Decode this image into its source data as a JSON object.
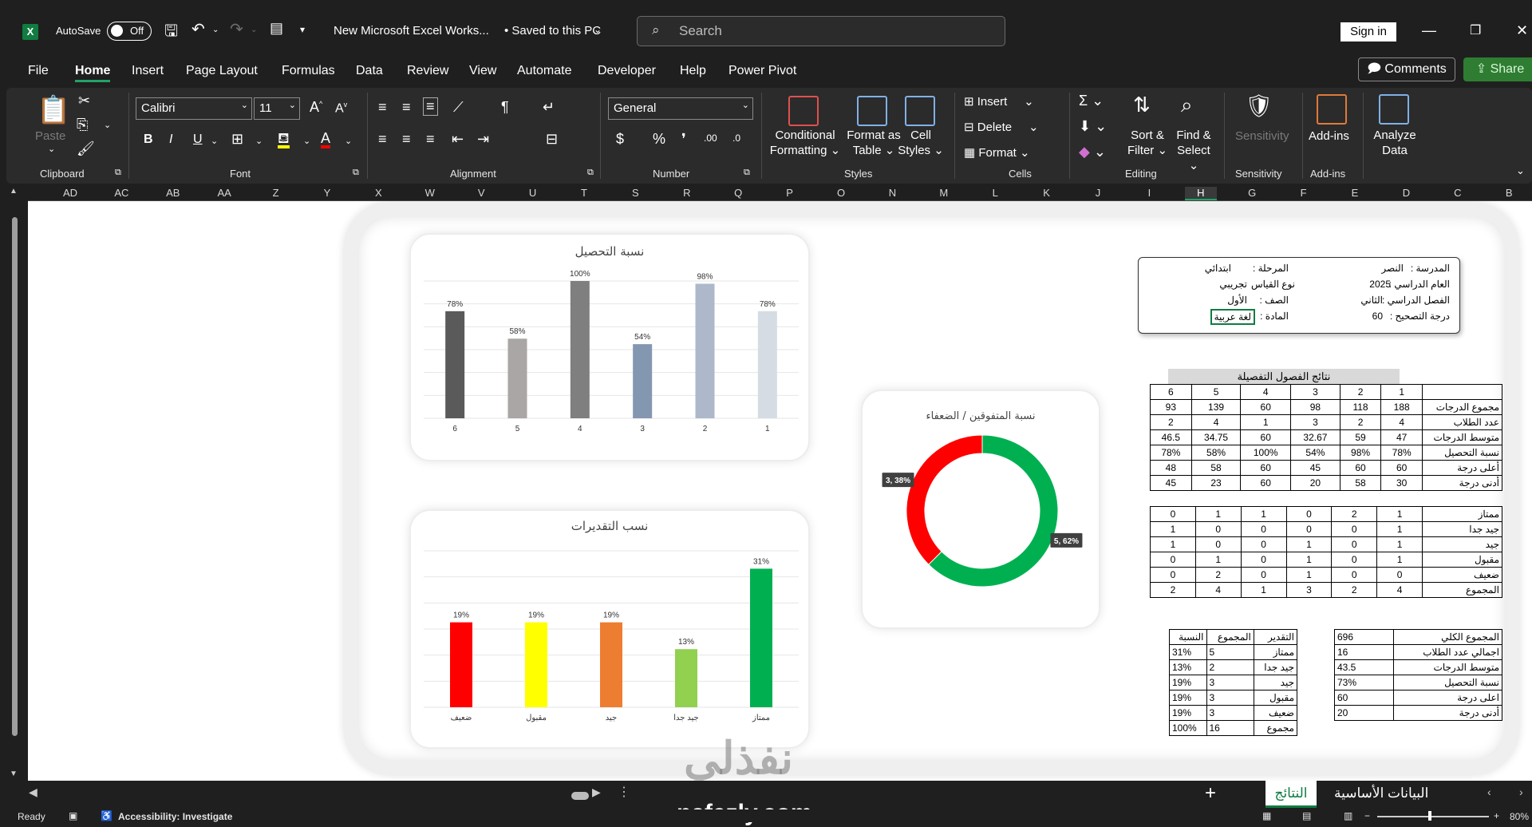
{
  "app": {
    "logo_letter": "X",
    "autosave_label": "AutoSave",
    "autosave_state": "Off",
    "document_title": "New Microsoft Excel Works...",
    "save_status": "• Saved to this PC",
    "search_placeholder": "Search",
    "sign_in": "Sign in"
  },
  "menu": [
    "File",
    "Home",
    "Insert",
    "Page Layout",
    "Formulas",
    "Data",
    "Review",
    "View",
    "Automate",
    "Developer",
    "Help",
    "Power Pivot"
  ],
  "menu_active": "Home",
  "right_buttons": {
    "comments": "Comments",
    "share": "Share"
  },
  "ribbon": {
    "clipboard": {
      "label": "Clipboard",
      "paste": "Paste"
    },
    "font": {
      "label": "Font",
      "family": "Calibri",
      "size": "11"
    },
    "alignment": {
      "label": "Alignment"
    },
    "number": {
      "label": "Number",
      "format": "General"
    },
    "styles": {
      "label": "Styles",
      "conditional": [
        "Conditional",
        "Formatting"
      ],
      "format_table": [
        "Format as",
        "Table"
      ],
      "cell_styles": [
        "Cell",
        "Styles"
      ]
    },
    "cells": {
      "label": "Cells",
      "insert": "Insert",
      "delete": "Delete",
      "format": "Format"
    },
    "editing": {
      "label": "Editing",
      "sort": [
        "Sort &",
        "Filter"
      ],
      "find": [
        "Find &",
        "Select"
      ]
    },
    "sensitivity": {
      "label": "Sensitivity",
      "button": "Sensitivity"
    },
    "addins": {
      "label": "Add-ins",
      "button": "Add-ins"
    },
    "analyze": {
      "button": [
        "Analyze",
        "Data"
      ]
    }
  },
  "columns": [
    "AD",
    "AC",
    "AB",
    "AA",
    "Z",
    "Y",
    "X",
    "W",
    "V",
    "U",
    "T",
    "S",
    "R",
    "Q",
    "P",
    "O",
    "N",
    "M",
    "L",
    "K",
    "J",
    "I",
    "H",
    "G",
    "F",
    "E",
    "D",
    "C",
    "B"
  ],
  "selected_column": "H",
  "info": {
    "school_label": "المدرسة :",
    "school_value": "النصر",
    "stage_label": "المرحلة :",
    "stage_value": "ابتدائي",
    "year_label": "العام الدراسي :",
    "year_value": "2025",
    "test_label": "نوع القياس",
    "test_value": "تجريبي",
    "semester_label": "الفصل الدراسي :",
    "semester_value": "الثاني",
    "grade_label": "الصف :",
    "grade_value": "الأول",
    "score_label": "درجة التصحيح :",
    "score_value": "60",
    "subject_label": "المادة :",
    "subject_value": "لغة عربية"
  },
  "results_header": "نتائج الفصول التفصيلة",
  "detail_table": {
    "class_numbers": [
      "1",
      "2",
      "3",
      "4",
      "5",
      "6"
    ],
    "rows": [
      {
        "label": "مجموع الدرجات",
        "values": [
          "188",
          "118",
          "98",
          "60",
          "139",
          "93"
        ]
      },
      {
        "label": "عدد الطلاب",
        "values": [
          "4",
          "2",
          "3",
          "1",
          "4",
          "2"
        ]
      },
      {
        "label": "متوسط الدرجات",
        "values": [
          "47",
          "59",
          "32.67",
          "60",
          "34.75",
          "46.5"
        ]
      },
      {
        "label": "نسبة التحصيل",
        "values": [
          "78%",
          "98%",
          "54%",
          "100%",
          "58%",
          "78%"
        ]
      },
      {
        "label": "أعلى درجة",
        "values": [
          "60",
          "60",
          "45",
          "60",
          "58",
          "48"
        ]
      },
      {
        "label": "أدنى درجة",
        "values": [
          "30",
          "58",
          "20",
          "60",
          "23",
          "45"
        ]
      }
    ]
  },
  "grades_table": {
    "rows": [
      {
        "label": "ممتاز",
        "values": [
          "1",
          "2",
          "0",
          "1",
          "1",
          "0"
        ]
      },
      {
        "label": "جيد جدا",
        "values": [
          "1",
          "0",
          "0",
          "0",
          "0",
          "1"
        ]
      },
      {
        "label": "جيد",
        "values": [
          "1",
          "0",
          "1",
          "0",
          "0",
          "1"
        ]
      },
      {
        "label": "مقبول",
        "values": [
          "1",
          "0",
          "1",
          "0",
          "1",
          "0"
        ]
      },
      {
        "label": "ضعيف",
        "values": [
          "0",
          "0",
          "1",
          "0",
          "2",
          "0"
        ]
      },
      {
        "label": "المجموع",
        "values": [
          "4",
          "2",
          "3",
          "1",
          "4",
          "2"
        ]
      }
    ]
  },
  "summary_table": {
    "rows": [
      {
        "label": "المجموع الكلي",
        "value": "696"
      },
      {
        "label": "اجمالي عدد الطلاب",
        "value": "16"
      },
      {
        "label": "متوسط الدرجات",
        "value": "43.5"
      },
      {
        "label": "نسبة التحصيل",
        "value": "73%"
      },
      {
        "label": "اعلى درجة",
        "value": "60"
      },
      {
        "label": "أدنى درجة",
        "value": "20"
      }
    ]
  },
  "grade_pct_table": {
    "headers": [
      "التقدير",
      "المجموع",
      "النسبة"
    ],
    "rows": [
      {
        "label": "ممتاز",
        "count": "5",
        "pct": "31%"
      },
      {
        "label": "جيد جدا",
        "count": "2",
        "pct": "13%"
      },
      {
        "label": "جيد",
        "count": "3",
        "pct": "19%"
      },
      {
        "label": "مقبول",
        "count": "3",
        "pct": "19%"
      },
      {
        "label": "ضعيف",
        "count": "3",
        "pct": "19%"
      },
      {
        "label": "مجموع",
        "count": "16",
        "pct": "100%"
      }
    ]
  },
  "chart_data": [
    {
      "type": "bar",
      "title": "نسبة التحصيل",
      "categories": [
        "6",
        "5",
        "4",
        "3",
        "2",
        "1"
      ],
      "values": [
        78,
        58,
        100,
        54,
        98,
        78
      ],
      "value_labels": [
        "78%",
        "58%",
        "100%",
        "54%",
        "98%",
        "78%"
      ],
      "colors": [
        "#5a5a5a",
        "#aaa6a6",
        "#7f7f7f",
        "#8497b0",
        "#adb9ca",
        "#d6dce4"
      ],
      "ylim": [
        0,
        100
      ],
      "grid": true
    },
    {
      "type": "bar",
      "title": "نسب التقديرات",
      "categories": [
        "ضعيف",
        "مقبول",
        "جيد",
        "جيد جدا",
        "ممتاز"
      ],
      "values": [
        19,
        19,
        19,
        13,
        31
      ],
      "value_labels": [
        "19%",
        "19%",
        "19%",
        "13%",
        "31%"
      ],
      "colors": [
        "#ff0000",
        "#ffff00",
        "#ed7d31",
        "#92d050",
        "#00b050"
      ],
      "ylim": [
        0,
        35
      ],
      "grid": true
    },
    {
      "type": "pie",
      "title": "نسبة المتفوقين / الضعفاء",
      "slices": [
        {
          "value": 5,
          "percent": 62,
          "label": "5, 62%",
          "color": "#00b050"
        },
        {
          "value": 3,
          "percent": 38,
          "label": "3, 38%",
          "color": "#ff0000"
        }
      ]
    }
  ],
  "sheet_tabs": {
    "active": "النتائج",
    "other": "البيانات الأساسية",
    "add": "+"
  },
  "status": {
    "ready": "Ready",
    "accessibility": "Accessibility: Investigate",
    "zoom": "80%"
  },
  "watermark": {
    "logo": "نفذلي",
    "url": "nafezly.com"
  }
}
